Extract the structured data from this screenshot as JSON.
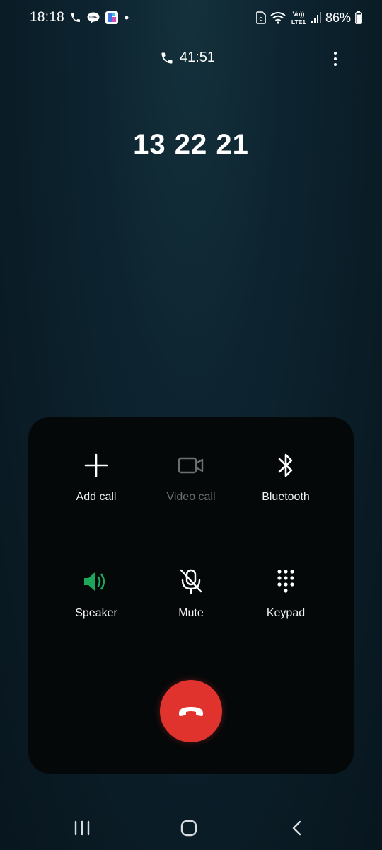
{
  "status_bar": {
    "time": "18:18",
    "battery_percent": "86%",
    "network_label": "Vo)) LTE1"
  },
  "call": {
    "duration": "41:51",
    "number": "13 22 21"
  },
  "actions": {
    "add_call": "Add call",
    "video_call": "Video call",
    "bluetooth": "Bluetooth",
    "speaker": "Speaker",
    "mute": "Mute",
    "keypad": "Keypad"
  },
  "colors": {
    "speaker_active": "#1ea75a",
    "end_call": "#e0332e",
    "disabled": "#6b6f71"
  },
  "icons": {
    "end_call": "phone-hangup-icon",
    "more": "more-vertical-icon"
  }
}
